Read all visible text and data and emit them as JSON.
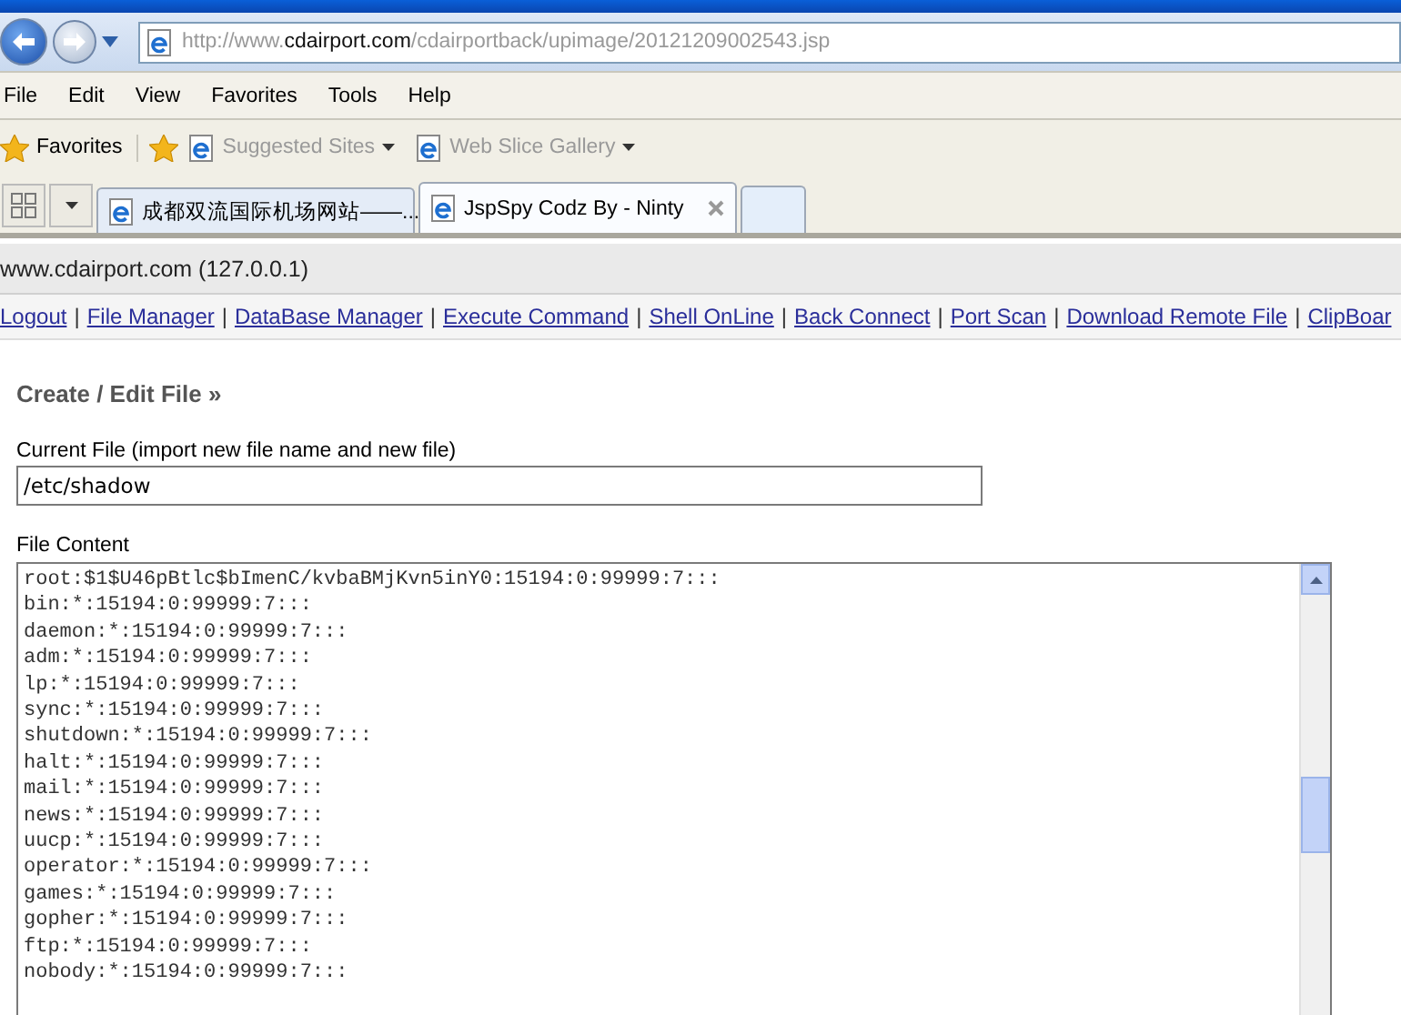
{
  "browser": {
    "address_parts": [
      {
        "text": "http://www.",
        "emphasis": false
      },
      {
        "text": "cdairport.com",
        "emphasis": true
      },
      {
        "text": "/cdairportback/upimage/20121209002543.jsp",
        "emphasis": false
      }
    ],
    "menu": [
      "File",
      "Edit",
      "View",
      "Favorites",
      "Tools",
      "Help"
    ],
    "favorites_bar": {
      "label": "Favorites",
      "items": [
        {
          "label": "Suggested Sites"
        },
        {
          "label": "Web Slice Gallery"
        }
      ]
    },
    "tabs": [
      {
        "label": "成都双流国际机场网站——...",
        "selected": false
      },
      {
        "label": "JspSpy Codz By - Ninty",
        "selected": true
      }
    ]
  },
  "page": {
    "host": "www.cdairport.com (127.0.0.1)",
    "nav_separator": "|",
    "nav_links": [
      "Logout",
      "File Manager",
      "DataBase Manager",
      "Execute Command",
      "Shell OnLine",
      "Back Connect",
      "Port Scan",
      "Download Remote File",
      "ClipBoar"
    ],
    "heading": "Create / Edit File »",
    "current_file": {
      "label": "Current File (import new file name and new file)",
      "value": "/etc/shadow"
    },
    "file_content": {
      "label": "File Content",
      "lines": [
        "root:$1$U46pBtlc$bImenC/kvbaBMjKvn5inY0:15194:0:99999:7:::",
        "bin:*:15194:0:99999:7:::",
        "daemon:*:15194:0:99999:7:::",
        "adm:*:15194:0:99999:7:::",
        "lp:*:15194:0:99999:7:::",
        "sync:*:15194:0:99999:7:::",
        "shutdown:*:15194:0:99999:7:::",
        "halt:*:15194:0:99999:7:::",
        "mail:*:15194:0:99999:7:::",
        "news:*:15194:0:99999:7:::",
        "uucp:*:15194:0:99999:7:::",
        "operator:*:15194:0:99999:7:::",
        "games:*:15194:0:99999:7:::",
        "gopher:*:15194:0:99999:7:::",
        "ftp:*:15194:0:99999:7:::",
        "nobody:*:15194:0:99999:7:::"
      ]
    }
  }
}
